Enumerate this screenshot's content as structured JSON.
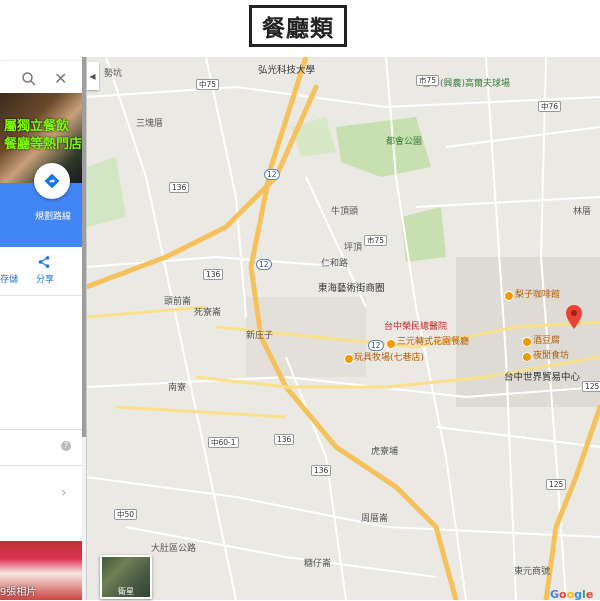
{
  "banner": {
    "title": "餐廳類"
  },
  "sidebar": {
    "search": {
      "close": "✕"
    },
    "hero_text": [
      "屬獨立餐飲",
      "餐廳等熱門店"
    ],
    "route_label": "規劃路線",
    "save_label": "存儲",
    "share_label": "分享",
    "help": "?",
    "photo_label": "9張相片"
  },
  "map": {
    "places": {
      "hongguang": "弘光科技大學",
      "taichung_yongan": "台中(興農)高爾夫球場",
      "tougua": "勢坑",
      "sanjiao": "三塊厝",
      "dushi_park": "都會公園",
      "niudingtou": "牛頂頭",
      "pingding": "坪頂",
      "donghai": "東海藝術街商圈",
      "lizi": "梨子咖啡館",
      "hospital": "台中榮民總醫院",
      "sanshan": "三元轉式花園餐廳",
      "wanju": "玩具牧場(七巷店)",
      "jiudouxia": "酒豆腐",
      "yeguan": "夜閒食坊",
      "trade": "台中世界貿易中心",
      "nanshi": "南寮",
      "huliao": "虎寮埔",
      "zhoucuo": "周厝崙",
      "zhuangzi": "新庄子",
      "kangmu": "糖仔崙",
      "dongda": "大肚區公路",
      "zhangang": "頭前崙",
      "sicuo": "死寮崙",
      "lin": "林厝",
      "renhe": "仁和路",
      "dongyuan": "東元商號"
    },
    "shields": {
      "r136a": "136",
      "r136b": "136",
      "r136c": "136",
      "r136d": "136",
      "r12a": "12",
      "r12b": "12",
      "r12c": "12",
      "r125": "125",
      "r75a": "市75",
      "r75b": "中75",
      "r76": "中76",
      "r60": "中60-1",
      "r50": "中50",
      "r125b": "125"
    },
    "satellite_label": "衛星",
    "google": "Google"
  },
  "colors": {
    "google": [
      "#4285f4",
      "#ea4335",
      "#fbbc05",
      "#4285f4",
      "#34a853",
      "#ea4335"
    ]
  }
}
